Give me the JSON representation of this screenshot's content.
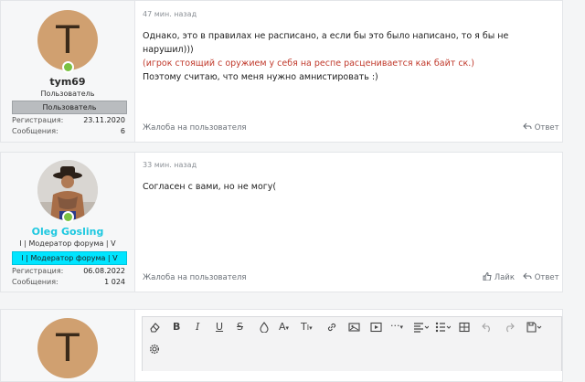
{
  "posts": [
    {
      "avatar_letter": "T",
      "username": "tym69",
      "user_title": "Пользователь",
      "user_banner": "Пользователь",
      "reg_label": "Регистрация:",
      "reg_value": "23.11.2020",
      "msgs_label": "Сообщения:",
      "msgs_value": "6",
      "time": "47 мин. назад",
      "line1": "Однако, это в правилах не расписано, а если бы это было написано, то я бы не нарушил)))",
      "line2": "(игрок стоящий с оружием у себя на респе расценивается как байт ск.)",
      "line3": "Поэтому считаю, что меня нужно амнистировать :)",
      "report": "Жалоба на пользователя",
      "reply": "Ответ"
    },
    {
      "username": "Oleg Gosling",
      "user_title": "I | Модератор форума | V",
      "user_banner": "I | Модератор форума | V",
      "reg_label": "Регистрация:",
      "reg_value": "06.08.2022",
      "msgs_label": "Сообщения:",
      "msgs_value": "1 024",
      "time": "33 мин. назад",
      "line1": "Согласен с вами, но не могу(",
      "report": "Жалоба на пользователя",
      "like": "Лайк",
      "reply": "Ответ"
    }
  ],
  "reply_box": {
    "avatar_letter": "T"
  },
  "colors": {
    "accent_cyan": "#00e5ff",
    "red_text": "#c0392b",
    "online": "#7ac142"
  },
  "toolbar_icons": [
    "eraser-icon",
    "bold-icon",
    "italic-icon",
    "underline-icon",
    "strike-icon",
    "color-icon",
    "font-size-icon",
    "text-height-icon",
    "link-icon",
    "image-icon",
    "media-icon",
    "more-icon",
    "align-icon",
    "list-icon",
    "table-icon",
    "undo-icon",
    "redo-icon",
    "save-draft-icon",
    "settings-icon"
  ]
}
